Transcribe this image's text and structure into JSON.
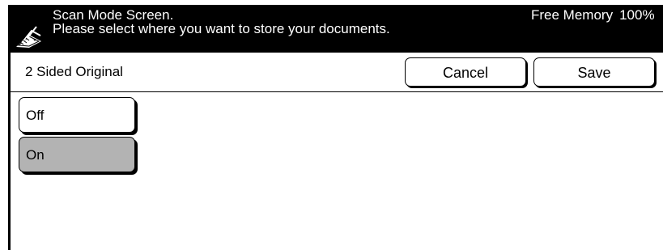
{
  "header": {
    "line1": "Scan Mode Screen.",
    "line2": "Please select where you want to store your documents.",
    "memory_label": "Free Memory",
    "memory_value": "100%",
    "icon": "scanner-icon"
  },
  "feature": {
    "title": "2 Sided Original",
    "cancel_label": "Cancel",
    "save_label": "Save"
  },
  "options": [
    {
      "label": "Off",
      "selected": false
    },
    {
      "label": "On",
      "selected": true
    }
  ],
  "colors": {
    "header_bg": "#000000",
    "selected_option": "#b3b3b3"
  }
}
